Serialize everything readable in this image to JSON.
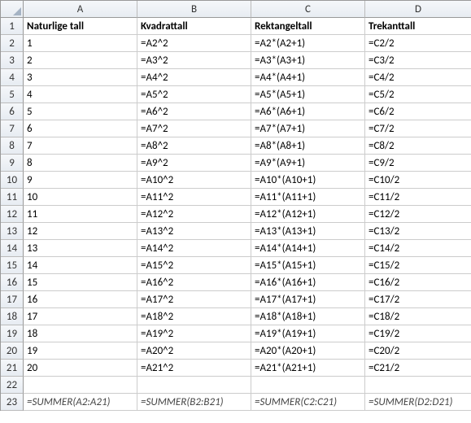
{
  "columns": [
    "",
    "A",
    "B",
    "C",
    "D"
  ],
  "rows": [
    {
      "num": "1",
      "cells": [
        "Naturlige tall",
        "Kvadrattall",
        "Rektangeltall",
        "Trekanttall"
      ],
      "bold": true
    },
    {
      "num": "2",
      "cells": [
        "1",
        "=A2^2",
        "=A2*(A2+1)",
        "=C2/2"
      ]
    },
    {
      "num": "3",
      "cells": [
        "2",
        "=A3^2",
        "=A3*(A3+1)",
        "=C3/2"
      ]
    },
    {
      "num": "4",
      "cells": [
        "3",
        "=A4^2",
        "=A4*(A4+1)",
        "=C4/2"
      ]
    },
    {
      "num": "5",
      "cells": [
        "4",
        "=A5^2",
        "=A5*(A5+1)",
        "=C5/2"
      ]
    },
    {
      "num": "6",
      "cells": [
        "5",
        "=A6^2",
        "=A6*(A6+1)",
        "=C6/2"
      ]
    },
    {
      "num": "7",
      "cells": [
        "6",
        "=A7^2",
        "=A7*(A7+1)",
        "=C7/2"
      ]
    },
    {
      "num": "8",
      "cells": [
        "7",
        "=A8^2",
        "=A8*(A8+1)",
        "=C8/2"
      ]
    },
    {
      "num": "9",
      "cells": [
        "8",
        "=A9^2",
        "=A9*(A9+1)",
        "=C9/2"
      ]
    },
    {
      "num": "10",
      "cells": [
        "9",
        "=A10^2",
        "=A10*(A10+1)",
        "=C10/2"
      ]
    },
    {
      "num": "11",
      "cells": [
        "10",
        "=A11^2",
        "=A11*(A11+1)",
        "=C11/2"
      ]
    },
    {
      "num": "12",
      "cells": [
        "11",
        "=A12^2",
        "=A12*(A12+1)",
        "=C12/2"
      ]
    },
    {
      "num": "13",
      "cells": [
        "12",
        "=A13^2",
        "=A13*(A13+1)",
        "=C13/2"
      ]
    },
    {
      "num": "14",
      "cells": [
        "13",
        "=A14^2",
        "=A14*(A14+1)",
        "=C14/2"
      ]
    },
    {
      "num": "15",
      "cells": [
        "14",
        "=A15^2",
        "=A15*(A15+1)",
        "=C15/2"
      ]
    },
    {
      "num": "16",
      "cells": [
        "15",
        "=A16^2",
        "=A16*(A16+1)",
        "=C16/2"
      ]
    },
    {
      "num": "17",
      "cells": [
        "16",
        "=A17^2",
        "=A17*(A17+1)",
        "=C17/2"
      ]
    },
    {
      "num": "18",
      "cells": [
        "17",
        "=A18^2",
        "=A18*(A18+1)",
        "=C18/2"
      ]
    },
    {
      "num": "19",
      "cells": [
        "18",
        "=A19^2",
        "=A19*(A19+1)",
        "=C19/2"
      ]
    },
    {
      "num": "20",
      "cells": [
        "19",
        "=A20^2",
        "=A20*(A20+1)",
        "=C20/2"
      ]
    },
    {
      "num": "21",
      "cells": [
        "20",
        "=A21^2",
        "=A21*(A21+1)",
        "=C21/2"
      ]
    },
    {
      "num": "22",
      "cells": [
        "",
        "",
        "",
        ""
      ]
    },
    {
      "num": "23",
      "cells": [
        "=SUMMER(A2:A21)",
        "=SUMMER(B2:B21)",
        "=SUMMER(C2:C21)",
        "=SUMMER(D2:D21)"
      ],
      "italic": true
    }
  ]
}
